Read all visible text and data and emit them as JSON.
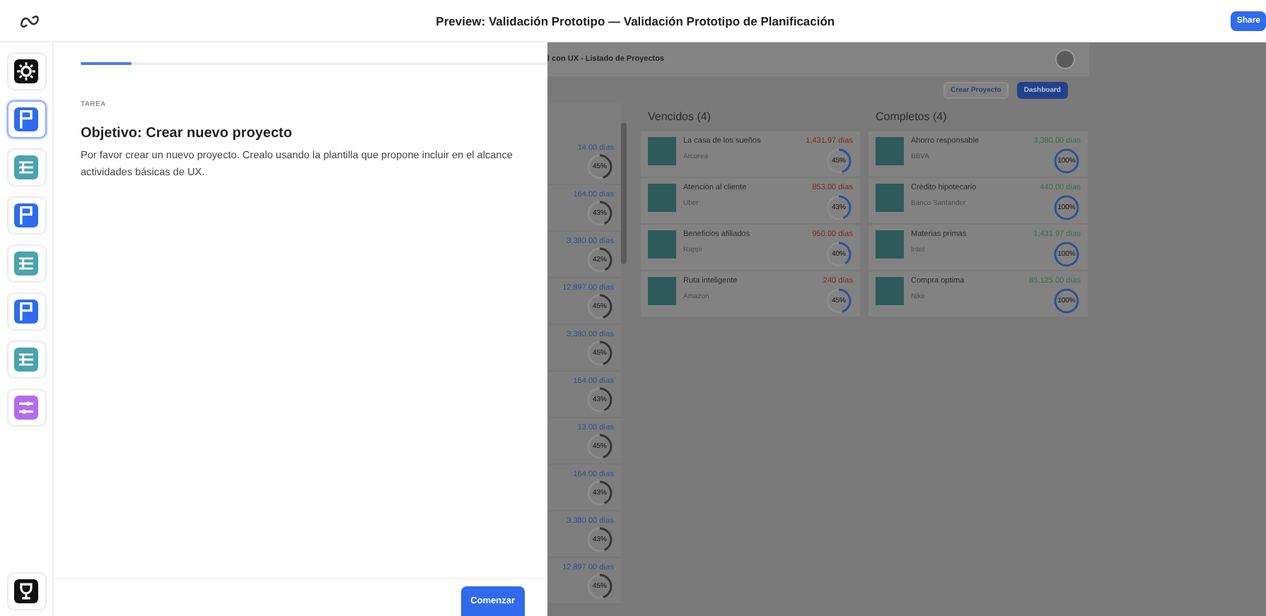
{
  "window": {
    "title": "Preview: Validación Prototipo — Validación Prototipo de Planificación",
    "share_button": "Share"
  },
  "rail": {
    "items": [
      {
        "kind": "settings",
        "selected": false
      },
      {
        "kind": "flag",
        "selected": true
      },
      {
        "kind": "list",
        "selected": false
      },
      {
        "kind": "flag",
        "selected": false
      },
      {
        "kind": "list",
        "selected": false
      },
      {
        "kind": "flag",
        "selected": false
      },
      {
        "kind": "list",
        "selected": false
      },
      {
        "kind": "filter",
        "selected": false
      }
    ],
    "footer_item": {
      "kind": "trophy"
    }
  },
  "task_panel": {
    "progress": {
      "level": 0.11
    },
    "eyebrow": "TAREA",
    "heading": "Objetivo: Crear nuevo proyecto",
    "body": "Por favor crear un nuevo proyecto. Crealo usando la plantilla que propone incluir en el alcance actividades básicas de UX.",
    "start_button": "Comenzar"
  },
  "background_app": {
    "title": "l con UX - Listado de Proyectos",
    "buttons": [
      {
        "label": "Crear Proyecto",
        "kind": "outline"
      },
      {
        "label": "Dashboard",
        "kind": "primary"
      }
    ],
    "left_column": [
      {
        "days": "14.00 días",
        "percent": "45%",
        "level": 0.45
      },
      {
        "days": "164.00 días",
        "percent": "43%",
        "level": 0.43
      },
      {
        "days": "3,380.00 días",
        "percent": "42%",
        "level": 0.42
      },
      {
        "days": "12,897.00 días",
        "percent": "45%",
        "level": 0.45
      },
      {
        "days": "3,380.00 días",
        "percent": "45%",
        "level": 0.45
      },
      {
        "days": "164.00 días",
        "percent": "43%",
        "level": 0.43
      },
      {
        "days": "13.00 días",
        "percent": "45%",
        "level": 0.45
      },
      {
        "days": "164.00 días",
        "percent": "43%",
        "level": 0.43
      },
      {
        "days": "3,380.00 días",
        "percent": "43%",
        "level": 0.43
      },
      {
        "days": "12,897.00 días",
        "percent": "45%",
        "level": 0.45
      }
    ],
    "columns": [
      {
        "title": "Vencidos (4)",
        "color": "#7d2424",
        "cards": [
          {
            "name": "La casa de los sueños",
            "company": "Arcorea",
            "days": "1,431.97 días",
            "percent": "45%",
            "level": 0.45
          },
          {
            "name": "Atención al cliente",
            "company": "Uber",
            "days": "853.00 días",
            "percent": "43%",
            "level": 0.43
          },
          {
            "name": "Beneficios afiliados",
            "company": "Rappi",
            "days": "950.00 días",
            "percent": "40%",
            "level": 0.4
          },
          {
            "name": "Ruta inteligente",
            "company": "Amazon",
            "days": "240 días",
            "percent": "45%",
            "level": 0.45
          }
        ]
      },
      {
        "title": "Completos (4)",
        "color": "#3e6a4c",
        "cards": [
          {
            "name": "Ahorro responsable",
            "company": "BBVA",
            "days": "3,380.00 días",
            "percent": "100%",
            "level": 1
          },
          {
            "name": "Crédito hipotecario",
            "company": "Banco Santander",
            "days": "440.00 días",
            "percent": "100%",
            "level": 1
          },
          {
            "name": "Materias primas",
            "company": "Intel",
            "days": "1,431.97 días",
            "percent": "100%",
            "level": 1
          },
          {
            "name": "Compra optima",
            "company": "Nike",
            "days": "85,125.00 días",
            "percent": "100%",
            "level": 1
          }
        ]
      }
    ]
  }
}
